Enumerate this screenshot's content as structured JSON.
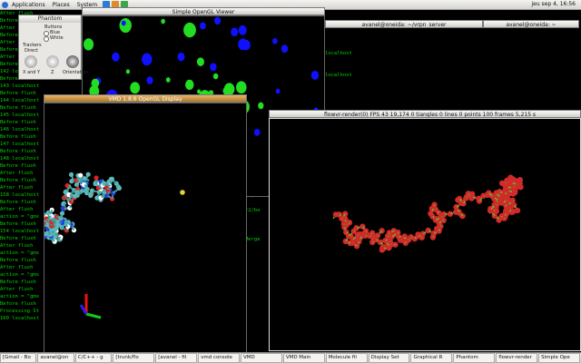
{
  "topbar": {
    "menus": [
      "Applications",
      "Places",
      "System"
    ],
    "clock": "jeu sep 4, 16:56"
  },
  "term_left": {
    "lines": [
      "After flush",
      "Before flush",
      "After flush",
      "Before flush",
      "After flush",
      "Before flush",
      "After flush",
      "Before flush",
      "142 localhost",
      "Before flush",
      "143 localhost",
      "Before flush",
      "144 localhost",
      "Before flush",
      "145 localhost",
      "Before flush",
      "146 localhost",
      "Before flush",
      "147 localhost",
      "Before flush",
      "148 localhost",
      "Before flush",
      "After flush",
      "Before flush",
      "After flush",
      "158 localhost",
      "Before flush",
      "After flush",
      "action = \"gmx",
      "Before flush",
      "154 localhost",
      "Before flush",
      "After flush",
      "action = \"gmx",
      "Before flush",
      "After flush",
      "action = \"gmx",
      "Before flush",
      "After flush",
      "action = \"gmx",
      "Before flush",
      "Processing St",
      "160 localhost"
    ]
  },
  "phantom": {
    "title": "Phantom",
    "buttons_label": "Buttons",
    "radio_blue": "Blue",
    "radio_white": "White",
    "trackers_label": "Trackers",
    "direct_label": "Direct",
    "tool1": "X and Y",
    "tool2": "Z",
    "tool3": "Orientation"
  },
  "opengl_viewer": {
    "title": "Simple OpenGL Viewer"
  },
  "vmd_display": {
    "title": "VMD 1.8.6 OpenGL Display"
  },
  "term_top_right": {
    "tab1": "avanel@oneida: ~/vrpn_server",
    "tab2": "avanel@oneida: ~",
    "lines": [
      "",
      "",
      "",
      "localhost",
      "",
      "",
      "localhost",
      "",
      "",
      "",
      "",
      "",
      "the dest localhost"
    ]
  },
  "term_under": {
    "lines": [
      "r2/bo",
      "",
      "r2/bo",
      "",
      "",
      "",
      "Merge"
    ]
  },
  "flowvr_render": {
    "title": "flowvr-render(0) FPS 43 19,174 0 tiangles 0 lines 0 points 100 frames 5,215 s"
  },
  "taskbar": {
    "items": [
      "[Gmail - Bo",
      "avanel@on",
      "C/C++ - g",
      "[trunk/flo",
      "[avanel - fil",
      "vmd console",
      "VMD",
      "VMD Main",
      "Molecule fil",
      "Display Set",
      "Graphical R",
      "Phantom",
      "flowvr-render",
      "Simple Ope"
    ]
  }
}
